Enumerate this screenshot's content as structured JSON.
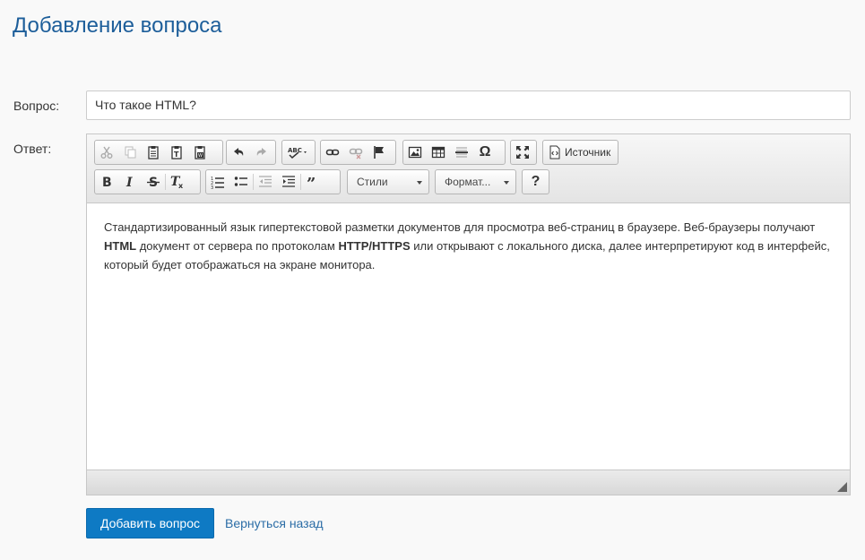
{
  "page": {
    "title": "Добавление вопроса"
  },
  "form": {
    "question_label": "Вопрос:",
    "question_value": "Что такое HTML?",
    "answer_label": "Ответ:"
  },
  "editor": {
    "toolbar": {
      "source_label": "Источник",
      "styles_label": "Стили",
      "format_label": "Формат...",
      "help_label": "?",
      "omega_label": "Ω"
    },
    "content": {
      "line1": "Стандартизированный язык гипертекстовой разметки документов для просмотра веб-страниц в браузере. Веб-браузеры получают",
      "html_bold": "HTML",
      "line2_a": " документ от сервера по протоколам ",
      "protocols_bold": "HTTP/HTTPS",
      "line2_b": " или открывают с локального диска, далее интерпретируют код в интерфейс,",
      "line3": "который будет отображаться на экране монитора."
    }
  },
  "actions": {
    "submit_label": "Добавить вопрос",
    "back_label": "Вернуться назад"
  },
  "colors": {
    "title": "#1d5e9a",
    "primary_button": "#0e7ac4",
    "link": "#2b6da6"
  }
}
